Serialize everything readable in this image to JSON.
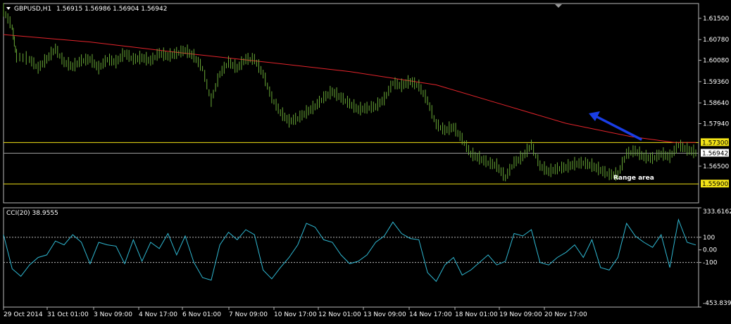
{
  "chart_data": [
    {
      "type": "candlestick",
      "title": "GBPUSD,H1",
      "ohlc_text": "1.56915 1.56986 1.56904 1.56942",
      "ylim": [
        1.5526,
        1.62
      ],
      "y_ticks": [
        "1.61500",
        "1.60780",
        "1.60080",
        "1.59360",
        "1.58640",
        "1.57940",
        "1.57300",
        "1.56942",
        "1.56500",
        "1.55900"
      ],
      "x_tick_labels": [
        "29 Oct 2014",
        "31 Oct 01:00",
        "3 Nov 09:00",
        "4 Nov 17:00",
        "6 Nov 01:00",
        "7 Nov 09:00",
        "10 Nov 17:00",
        "12 Nov 01:00",
        "13 Nov 09:00",
        "14 Nov 17:00",
        "18 Nov 01:00",
        "19 Nov 09:00",
        "20 Nov 17:00"
      ],
      "price_series": {
        "name": "GBPUSD",
        "color": "#6aaa37",
        "points": [
          [
            0,
            1.6175
          ],
          [
            2,
            1.612
          ],
          [
            3,
            1.602
          ],
          [
            6,
            1.601
          ],
          [
            8,
            1.598
          ],
          [
            10,
            1.601
          ],
          [
            12,
            1.6045
          ],
          [
            14,
            1.6
          ],
          [
            16,
            1.5985
          ],
          [
            18,
            1.6005
          ],
          [
            20,
            1.601
          ],
          [
            22,
            1.598
          ],
          [
            24,
            1.601
          ],
          [
            26,
            1.6
          ],
          [
            28,
            1.603
          ],
          [
            30,
            1.601
          ],
          [
            32,
            1.6015
          ],
          [
            34,
            1.6005
          ],
          [
            36,
            1.603
          ],
          [
            38,
            1.602
          ],
          [
            40,
            1.603
          ],
          [
            42,
            1.604
          ],
          [
            44,
            1.602
          ],
          [
            46,
            1.598
          ],
          [
            48,
            1.587
          ],
          [
            50,
            1.596
          ],
          [
            52,
            1.6
          ],
          [
            54,
            1.598
          ],
          [
            56,
            1.601
          ],
          [
            58,
            1.601
          ],
          [
            60,
            1.596
          ],
          [
            62,
            1.588
          ],
          [
            64,
            1.583
          ],
          [
            66,
            1.58
          ],
          [
            68,
            1.581
          ],
          [
            70,
            1.583
          ],
          [
            72,
            1.585
          ],
          [
            74,
            1.588
          ],
          [
            76,
            1.59
          ],
          [
            78,
            1.588
          ],
          [
            80,
            1.586
          ],
          [
            82,
            1.584
          ],
          [
            84,
            1.5845
          ],
          [
            86,
            1.585
          ],
          [
            88,
            1.5875
          ],
          [
            90,
            1.593
          ],
          [
            92,
            1.592
          ],
          [
            94,
            1.5935
          ],
          [
            96,
            1.592
          ],
          [
            98,
            1.587
          ],
          [
            100,
            1.579
          ],
          [
            102,
            1.577
          ],
          [
            104,
            1.578
          ],
          [
            106,
            1.574
          ],
          [
            108,
            1.569
          ],
          [
            110,
            1.5675
          ],
          [
            112,
            1.566
          ],
          [
            114,
            1.565
          ],
          [
            116,
            1.561
          ],
          [
            118,
            1.566
          ],
          [
            120,
            1.568
          ],
          [
            122,
            1.572
          ],
          [
            124,
            1.565
          ],
          [
            126,
            1.563
          ],
          [
            128,
            1.564
          ],
          [
            130,
            1.5645
          ],
          [
            132,
            1.5655
          ],
          [
            134,
            1.566
          ],
          [
            136,
            1.565
          ],
          [
            138,
            1.5635
          ],
          [
            140,
            1.562
          ],
          [
            142,
            1.562
          ],
          [
            144,
            1.569
          ],
          [
            146,
            1.57
          ],
          [
            148,
            1.568
          ],
          [
            150,
            1.5675
          ],
          [
            152,
            1.569
          ],
          [
            154,
            1.568
          ],
          [
            156,
            1.572
          ],
          [
            158,
            1.5705
          ],
          [
            160,
            1.5694
          ]
        ]
      },
      "ma_series": {
        "name": "",
        "color": "#e3242b",
        "points": [
          [
            0,
            1.6095
          ],
          [
            20,
            1.607
          ],
          [
            40,
            1.6035
          ],
          [
            60,
            1.6003
          ],
          [
            80,
            1.597
          ],
          [
            100,
            1.5925
          ],
          [
            115,
            1.586
          ],
          [
            130,
            1.5795
          ],
          [
            145,
            1.575
          ],
          [
            155,
            1.573
          ],
          [
            160,
            1.573
          ]
        ]
      },
      "hlines": [
        {
          "value": 1.573,
          "label": "1.57300",
          "color": "#f2e317"
        },
        {
          "value": 1.5694,
          "label": "1.56942",
          "color": "#9a9a9a"
        },
        {
          "value": 1.559,
          "label": "1.55900",
          "color": "#f2e317"
        }
      ],
      "annotation_text": "Range area",
      "arrow_color": "#1a3ee6"
    },
    {
      "type": "line",
      "title": "CCI(20) 38.9555",
      "ylim": [
        -453.8393,
        333.6162
      ],
      "y_ticks": [
        "333.6162",
        "100",
        "0.00",
        "-100",
        "-453.8393"
      ],
      "levels": [
        100,
        -100
      ],
      "series": [
        {
          "name": "",
          "color": "#2fb8d2",
          "points": [
            [
              0,
              120
            ],
            [
              2,
              -150
            ],
            [
              4,
              -210
            ],
            [
              6,
              -120
            ],
            [
              8,
              -60
            ],
            [
              10,
              -40
            ],
            [
              12,
              70
            ],
            [
              14,
              40
            ],
            [
              16,
              120
            ],
            [
              18,
              60
            ],
            [
              20,
              -110
            ],
            [
              22,
              60
            ],
            [
              24,
              40
            ],
            [
              26,
              30
            ],
            [
              28,
              -110
            ],
            [
              30,
              80
            ],
            [
              32,
              -90
            ],
            [
              34,
              60
            ],
            [
              36,
              10
            ],
            [
              38,
              130
            ],
            [
              40,
              -40
            ],
            [
              42,
              110
            ],
            [
              44,
              -100
            ],
            [
              46,
              -220
            ],
            [
              48,
              -240
            ],
            [
              50,
              40
            ],
            [
              52,
              140
            ],
            [
              54,
              80
            ],
            [
              56,
              160
            ],
            [
              58,
              120
            ],
            [
              60,
              -160
            ],
            [
              62,
              -230
            ],
            [
              64,
              -140
            ],
            [
              66,
              -60
            ],
            [
              68,
              40
            ],
            [
              70,
              210
            ],
            [
              72,
              180
            ],
            [
              74,
              80
            ],
            [
              76,
              60
            ],
            [
              78,
              -40
            ],
            [
              80,
              -110
            ],
            [
              82,
              -90
            ],
            [
              84,
              -40
            ],
            [
              86,
              60
            ],
            [
              88,
              110
            ],
            [
              90,
              220
            ],
            [
              92,
              130
            ],
            [
              94,
              90
            ],
            [
              96,
              80
            ],
            [
              98,
              -180
            ],
            [
              100,
              -250
            ],
            [
              102,
              -120
            ],
            [
              104,
              -60
            ],
            [
              106,
              -200
            ],
            [
              108,
              -160
            ],
            [
              110,
              -100
            ],
            [
              112,
              -40
            ],
            [
              114,
              -120
            ],
            [
              116,
              -90
            ],
            [
              118,
              130
            ],
            [
              120,
              110
            ],
            [
              122,
              160
            ],
            [
              124,
              -100
            ],
            [
              126,
              -120
            ],
            [
              128,
              -60
            ],
            [
              130,
              -20
            ],
            [
              132,
              40
            ],
            [
              134,
              -60
            ],
            [
              136,
              80
            ],
            [
              138,
              -140
            ],
            [
              140,
              -160
            ],
            [
              142,
              -60
            ],
            [
              144,
              210
            ],
            [
              146,
              110
            ],
            [
              148,
              60
            ],
            [
              150,
              20
            ],
            [
              152,
              120
            ],
            [
              154,
              -140
            ],
            [
              156,
              240
            ],
            [
              158,
              60
            ],
            [
              160,
              39
            ]
          ]
        }
      ]
    }
  ]
}
